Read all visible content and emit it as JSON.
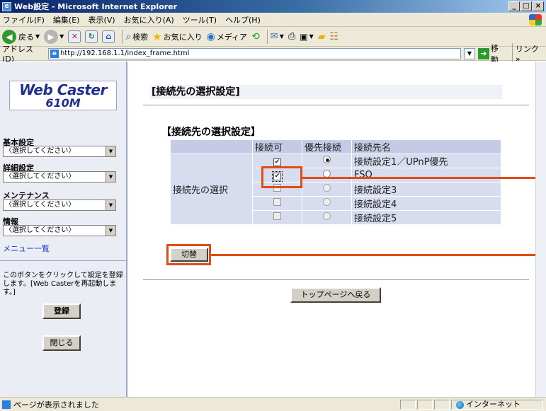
{
  "window": {
    "title": "Web設定 - Microsoft Internet Explorer",
    "buttons": [
      "_",
      "□",
      "×"
    ]
  },
  "menu": [
    "ファイル(F)",
    "編集(E)",
    "表示(V)",
    "お気に入り(A)",
    "ツール(T)",
    "ヘルプ(H)"
  ],
  "toolbar": {
    "back": "戻る",
    "search": "検索",
    "favorites": "お気に入り",
    "media": "メディア"
  },
  "address": {
    "label": "アドレス(D)",
    "url": "http://192.168.1.1/index_frame.html",
    "go": "移動",
    "links": "リンク »"
  },
  "sidebar": {
    "logo_line1": "Web Caster",
    "logo_line2": "610M",
    "groups": [
      {
        "label": "基本設定",
        "select": "〈選択してください〉"
      },
      {
        "label": "詳細設定",
        "select": "〈選択してください〉"
      },
      {
        "label": "メンテナンス",
        "select": "〈選択してください〉"
      },
      {
        "label": "情報",
        "select": "〈選択してください〉"
      }
    ],
    "menu_link": "メニュー一覧",
    "note": "このボタンをクリックして設定を登録します。[Web Casterを再起動します。]",
    "register_button": "登録",
    "close_button": "閉じる"
  },
  "main": {
    "heading": "[接続先の選択設定]",
    "section_title": "【接続先の選択設定】",
    "table": {
      "headers": [
        "接続可",
        "優先接続",
        "接続先名"
      ],
      "row_label": "接続先の選択",
      "rows": [
        {
          "enabled": true,
          "priority": true,
          "name": "接続設定1／UPnP優先",
          "disabled": false
        },
        {
          "enabled": true,
          "priority": false,
          "name": "FSQ",
          "disabled": false
        },
        {
          "enabled": false,
          "priority": false,
          "name": "接続設定3",
          "disabled": true
        },
        {
          "enabled": false,
          "priority": false,
          "name": "接続設定4",
          "disabled": true
        },
        {
          "enabled": false,
          "priority": false,
          "name": "接続設定5",
          "disabled": true
        }
      ]
    },
    "switch_button": "切替",
    "top_button": "トップページへ戻る"
  },
  "status": {
    "message": "ページが表示されました",
    "zone": "インターネット"
  },
  "colors": {
    "callout": "#e24d17",
    "table_bg": "#d7dcef"
  }
}
